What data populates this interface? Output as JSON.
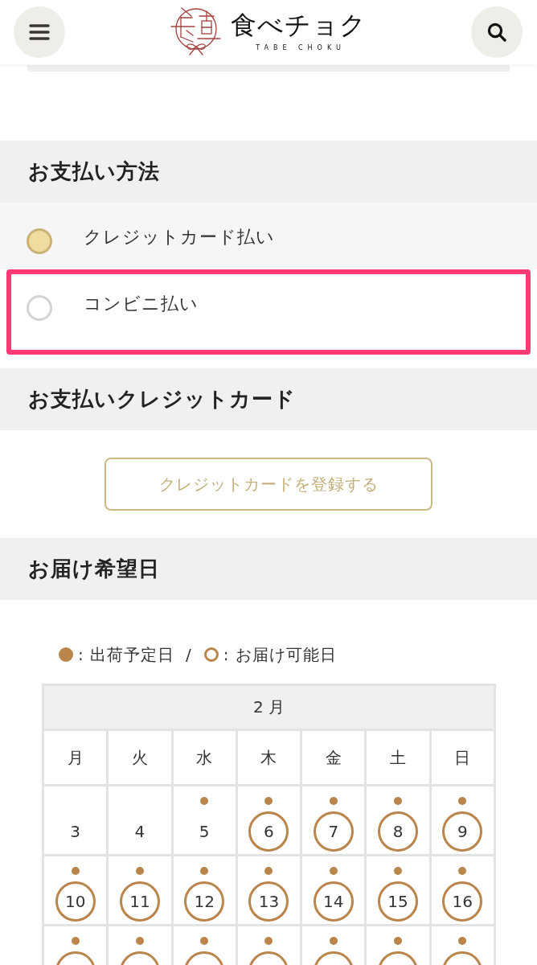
{
  "header": {
    "logo": {
      "name": "食べチョク",
      "romaji": "TABE CHOKU"
    }
  },
  "payment_method": {
    "title": "お支払い方法",
    "options": [
      {
        "label": "クレジットカード払い",
        "selected": true,
        "highlighted": false
      },
      {
        "label": "コンビニ払い",
        "selected": false,
        "highlighted": true
      }
    ]
  },
  "payment_card": {
    "title": "お支払いクレジットカード",
    "register_button": "クレジットカードを登録する"
  },
  "delivery_date": {
    "title": "お届け希望日",
    "legend": [
      {
        "kind": "dot",
        "label": ": 出荷予定日"
      },
      {
        "kind": "ring",
        "label": ": お届け可能日"
      }
    ],
    "legend_separator": "/",
    "calendar": {
      "month": "2 月",
      "weekdays": [
        "月",
        "火",
        "水",
        "木",
        "金",
        "土",
        "日"
      ],
      "weeks": [
        [
          {
            "day": "3",
            "shipping": false,
            "deliverable": false
          },
          {
            "day": "4",
            "shipping": false,
            "deliverable": false
          },
          {
            "day": "5",
            "shipping": true,
            "deliverable": false
          },
          {
            "day": "6",
            "shipping": true,
            "deliverable": true
          },
          {
            "day": "7",
            "shipping": true,
            "deliverable": true
          },
          {
            "day": "8",
            "shipping": true,
            "deliverable": true
          },
          {
            "day": "9",
            "shipping": true,
            "deliverable": true
          }
        ],
        [
          {
            "day": "10",
            "shipping": true,
            "deliverable": true
          },
          {
            "day": "11",
            "shipping": true,
            "deliverable": true
          },
          {
            "day": "12",
            "shipping": true,
            "deliverable": true
          },
          {
            "day": "13",
            "shipping": true,
            "deliverable": true
          },
          {
            "day": "14",
            "shipping": true,
            "deliverable": true
          },
          {
            "day": "15",
            "shipping": true,
            "deliverable": true
          },
          {
            "day": "16",
            "shipping": true,
            "deliverable": true
          }
        ],
        [
          {
            "shipping": true,
            "deliverable": true
          },
          {
            "shipping": true,
            "deliverable": true
          },
          {
            "shipping": true,
            "deliverable": true
          },
          {
            "shipping": true,
            "deliverable": true
          },
          {
            "shipping": true,
            "deliverable": true
          },
          {
            "shipping": true,
            "deliverable": true
          },
          {
            "shipping": true,
            "deliverable": true
          }
        ]
      ]
    }
  }
}
